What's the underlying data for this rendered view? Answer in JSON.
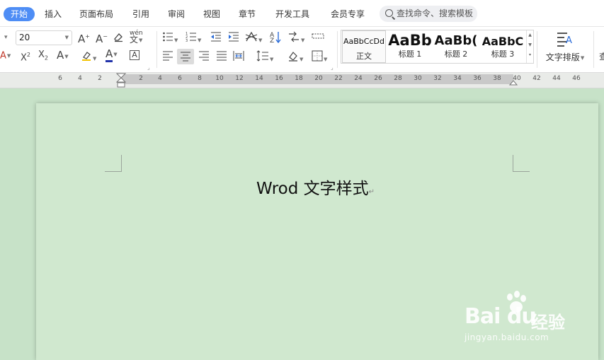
{
  "tabs": {
    "home": "开始",
    "insert": "插入",
    "page_layout": "页面布局",
    "references": "引用",
    "review": "审阅",
    "view": "视图",
    "chapter": "章节",
    "developer": "开发工具",
    "member": "会员专享"
  },
  "search": {
    "placeholder": "查找命令、搜索模板"
  },
  "toolbar": {
    "font_size": "20",
    "phonetic_label": "wén",
    "style_normal_sample": "AaBbCcDd",
    "style_normal_name": "正文",
    "style_h1_sample": "AaBb",
    "style_h1_name": "标题 1",
    "style_h2_sample": "AaBb(",
    "style_h2_name": "标题 2",
    "style_h3_sample": "AaBbC",
    "style_h3_name": "标题 3",
    "text_layout_label": "文字排版"
  },
  "ruler": {
    "ticks": [
      "6",
      "4",
      "2",
      "2",
      "4",
      "6",
      "8",
      "10",
      "12",
      "14",
      "16",
      "18",
      "20",
      "22",
      "24",
      "26",
      "28",
      "30",
      "32",
      "34",
      "36",
      "38",
      "40",
      "42",
      "44",
      "46"
    ]
  },
  "document": {
    "title": "Wrod 文字样式"
  },
  "watermark": {
    "brand": "Bai du",
    "brand_suffix": "经验",
    "url": "jingyan.baidu.com"
  }
}
